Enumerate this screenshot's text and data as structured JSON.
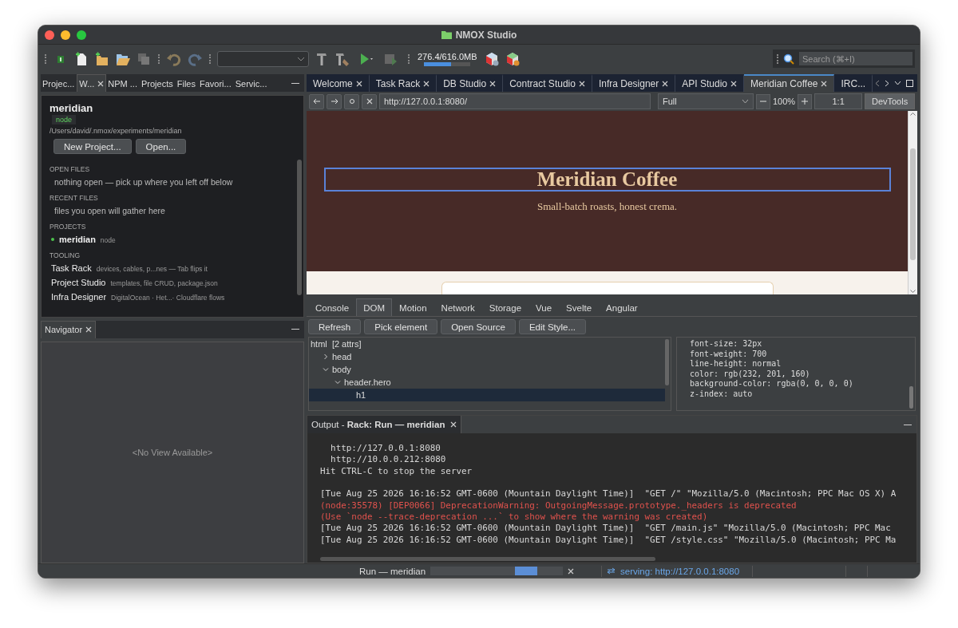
{
  "window": {
    "title": "NMOX Studio"
  },
  "toolbar": {
    "memory": {
      "reading": "276.4/616.0MB",
      "level": 0.58
    },
    "search": {
      "placeholder": "Search (⌘+I)"
    }
  },
  "left_tabs": [
    {
      "label": "Projec...",
      "selected": false,
      "closable": false
    },
    {
      "label": "W...",
      "selected": true,
      "closable": true
    },
    {
      "label": "NPM ...",
      "selected": false,
      "closable": false
    },
    {
      "label": "Projects",
      "selected": false,
      "closable": false
    },
    {
      "label": "Files",
      "selected": false,
      "closable": false
    },
    {
      "label": "Favori...",
      "selected": false,
      "closable": false
    },
    {
      "label": "Servic...",
      "selected": false,
      "closable": false
    }
  ],
  "welcome": {
    "project": "meridian",
    "badge": "node",
    "path": "/Users/david/.nmox/experiments/meridian",
    "buttons": [
      "New Project...",
      "Open..."
    ],
    "sections": [
      {
        "heading": "OPEN FILES",
        "kind": "note",
        "items": [
          {
            "text": "nothing open — pick up where you left off below"
          }
        ]
      },
      {
        "heading": "RECENT FILES",
        "kind": "note",
        "items": [
          {
            "text": "files you open will gather here"
          }
        ]
      },
      {
        "heading": "PROJECTS",
        "kind": "project",
        "items": [
          {
            "text": "meridian",
            "detail": "node",
            "color": "#4cc24c"
          }
        ]
      },
      {
        "heading": "TOOLING",
        "kind": "tool",
        "items": [
          {
            "text": "Task Rack",
            "detail": "devices, cables, p...nes — Tab flips it"
          },
          {
            "text": "Project Studio",
            "detail": "templates, file CRUD, package.json"
          },
          {
            "text": "Infra Designer",
            "detail": "DigitalOcean · Het...· Cloudflare flows"
          }
        ]
      }
    ]
  },
  "navigator": {
    "tab": "Navigator",
    "empty": "<No View Available>"
  },
  "editor_tabs": [
    {
      "label": "Welcome",
      "selected": false,
      "closable": true
    },
    {
      "label": "Task Rack",
      "selected": false,
      "closable": true
    },
    {
      "label": "DB Studio",
      "selected": false,
      "closable": true
    },
    {
      "label": "Contract Studio",
      "selected": false,
      "closable": true
    },
    {
      "label": "Infra Designer",
      "selected": false,
      "closable": true
    },
    {
      "label": "API Studio",
      "selected": false,
      "closable": true
    },
    {
      "label": "Meridian Coffee",
      "selected": true,
      "closable": true
    },
    {
      "label": "IRC...",
      "selected": false,
      "closable": false
    }
  ],
  "browser": {
    "url": "http://127.0.0.1:8080/",
    "zoom_mode": "Full",
    "zoom": "100%",
    "ratio": "1:1",
    "devtools": "DevTools",
    "page": {
      "heading": "Meridian Coffee",
      "tagline": "Small-batch roasts, honest crema."
    }
  },
  "devtools": {
    "tabs": [
      {
        "label": "Console",
        "selected": false
      },
      {
        "label": "DOM",
        "selected": true
      },
      {
        "label": "Motion",
        "selected": false
      },
      {
        "label": "Network",
        "selected": false
      },
      {
        "label": "Storage",
        "selected": false
      },
      {
        "label": "Vue",
        "selected": false
      },
      {
        "label": "Svelte",
        "selected": false
      },
      {
        "label": "Angular",
        "selected": false
      }
    ],
    "buttons": [
      "Refresh",
      "Pick element",
      "Open Source",
      "Edit Style..."
    ],
    "dom_tree": [
      {
        "label": "html  [2 attrs]",
        "selected": false,
        "children": [
          {
            "label": "head",
            "expanded": false,
            "selected": false
          },
          {
            "label": "body",
            "expanded": true,
            "selected": false,
            "children": [
              {
                "label": "header.hero",
                "expanded": true,
                "selected": false,
                "children": [
                  {
                    "label": "h1",
                    "selected": true
                  }
                ]
              }
            ]
          }
        ]
      }
    ],
    "styles": [
      "font-size: 32px",
      "font-weight: 700",
      "line-height: normal",
      "color: rgb(232, 201, 160)",
      "background-color: rgba(0, 0, 0, 0)",
      "z-index: auto"
    ]
  },
  "output": {
    "title": "Output - **Rack: Run — meridian**",
    "blocks": [
      [
        {
          "text": "  http://127.0.0.1:8080",
          "kind": "log"
        },
        {
          "text": "  http://10.0.0.212:8080",
          "kind": "log"
        },
        {
          "text": "Hit CTRL-C to stop the server",
          "kind": "log"
        }
      ],
      [
        {
          "text": "[Tue Aug 25 2026 16:16:52 GMT-0600 (Mountain Daylight Time)]  \"GET /\" \"Mozilla/5.0 (Macintosh; PPC Mac OS X) A",
          "kind": "log"
        },
        {
          "text": "(node:35578) [DEP0066] DeprecationWarning: OutgoingMessage.prototype._headers is deprecated",
          "kind": "error"
        },
        {
          "text": "(Use `node --trace-deprecation ...` to show where the warning was created)",
          "kind": "error"
        },
        {
          "text": "[Tue Aug 25 2026 16:16:52 GMT-0600 (Mountain Daylight Time)]  \"GET /main.js\" \"Mozilla/5.0 (Macintosh; PPC Mac",
          "kind": "log"
        },
        {
          "text": "[Tue Aug 25 2026 16:16:52 GMT-0600 (Mountain Daylight Time)]  \"GET /style.css\" \"Mozilla/5.0 (Macintosh; PPC Ma",
          "kind": "log"
        }
      ]
    ]
  },
  "status_bar": {
    "task": "Run — meridian",
    "serving": "serving: http://127.0.0.1:8080"
  }
}
